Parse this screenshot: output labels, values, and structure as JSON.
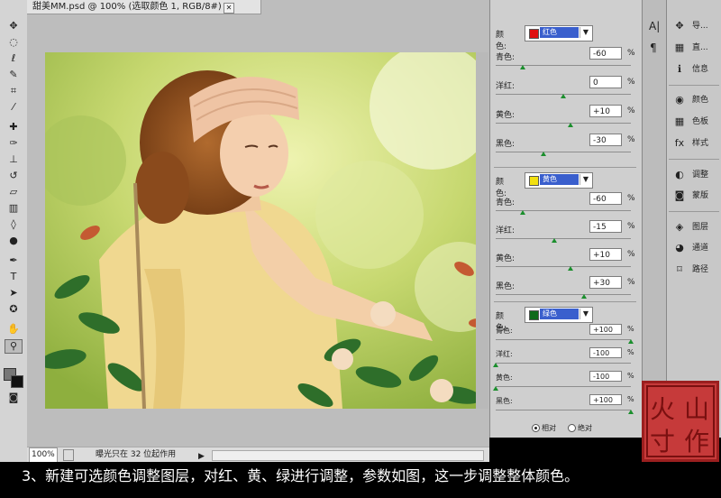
{
  "document": {
    "tab_title": "甜美MM.psd @ 100% (选取颜色 1, RGB/8#) *",
    "close_glyph": "✕",
    "zoom": "100%",
    "status": "曝光只在 32 位起作用"
  },
  "adjustments": {
    "groups": [
      {
        "selector_label": "颜色:",
        "selector_value": "红色",
        "swatch": "#e01010",
        "rows": [
          {
            "label": "青色:",
            "value": "-60",
            "pct": "%",
            "pos": 0.2
          },
          {
            "label": "洋红:",
            "value": "0",
            "pct": "%",
            "pos": 0.5
          },
          {
            "label": "黄色:",
            "value": "+10",
            "pct": "%",
            "pos": 0.55
          },
          {
            "label": "黑色:",
            "value": "-30",
            "pct": "%",
            "pos": 0.35
          }
        ]
      },
      {
        "selector_label": "颜色:",
        "selector_value": "黄色",
        "swatch": "#f2e010",
        "rows": [
          {
            "label": "青色:",
            "value": "-60",
            "pct": "%",
            "pos": 0.2
          },
          {
            "label": "洋红:",
            "value": "-15",
            "pct": "%",
            "pos": 0.43
          },
          {
            "label": "黄色:",
            "value": "+10",
            "pct": "%",
            "pos": 0.55
          },
          {
            "label": "黑色:",
            "value": "+30",
            "pct": "%",
            "pos": 0.65
          }
        ]
      },
      {
        "selector_label": "颜色:",
        "selector_value": "绿色",
        "swatch": "#0e6a1a",
        "rows": [
          {
            "label": "青色:",
            "value": "+100",
            "pct": "%",
            "pos": 1.0
          },
          {
            "label": "洋红:",
            "value": "-100",
            "pct": "%",
            "pos": 0.0
          },
          {
            "label": "黄色:",
            "value": "-100",
            "pct": "%",
            "pos": 0.0
          },
          {
            "label": "黑色:",
            "value": "+100",
            "pct": "%",
            "pos": 1.0
          }
        ]
      }
    ],
    "mode_relative": "相对",
    "mode_absolute": "绝对"
  },
  "dock_small": {
    "char_glyph": "A|",
    "para_glyph": "¶"
  },
  "dock": {
    "items": [
      {
        "icon": "navigator-icon",
        "glyph": "✥",
        "label": "导..."
      },
      {
        "icon": "histogram-icon",
        "glyph": "▦",
        "label": "直..."
      },
      {
        "icon": "info-icon",
        "glyph": "ℹ",
        "label": "信息"
      },
      {
        "icon": "color-icon",
        "glyph": "◉",
        "label": "颜色"
      },
      {
        "icon": "swatches-icon",
        "glyph": "▦",
        "label": "色板"
      },
      {
        "icon": "styles-icon",
        "glyph": "fx",
        "label": "样式"
      },
      {
        "icon": "adjustments-icon",
        "glyph": "◐",
        "label": "调整"
      },
      {
        "icon": "masks-icon",
        "glyph": "◙",
        "label": "蒙版"
      },
      {
        "icon": "layers-icon",
        "glyph": "◈",
        "label": "图层"
      },
      {
        "icon": "channels-icon",
        "glyph": "◕",
        "label": "通道"
      },
      {
        "icon": "paths-icon",
        "glyph": "⌑",
        "label": "路径"
      }
    ]
  },
  "caption": "3、新建可选颜色调整图层，对红、黄、绿进行调整，参数如图，这一步调整整体颜色。",
  "seal_text": [
    "火",
    "山",
    "寸",
    "作"
  ]
}
